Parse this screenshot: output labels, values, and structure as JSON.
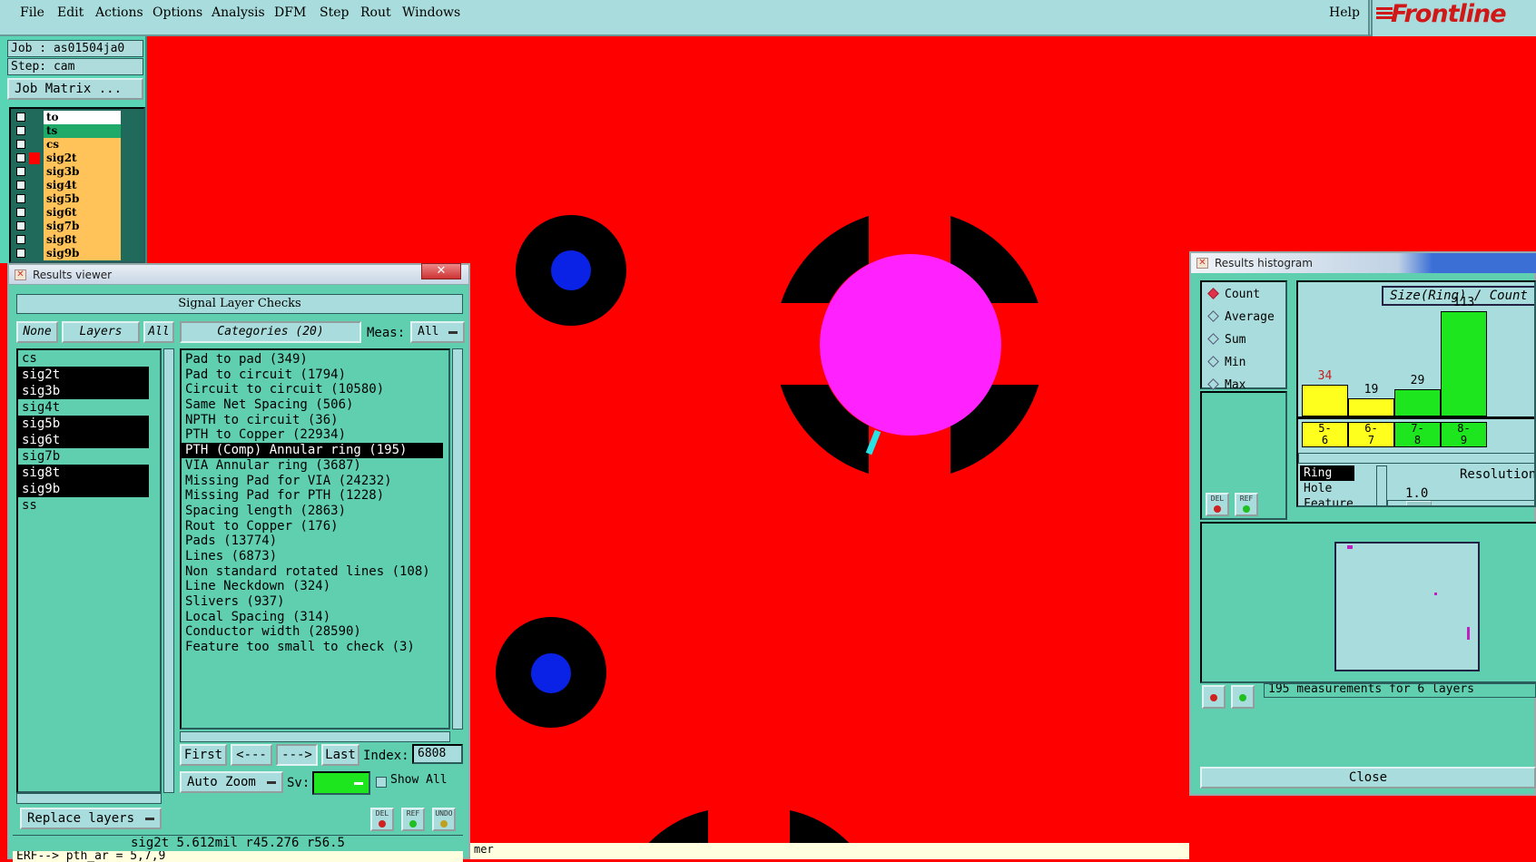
{
  "menu": {
    "items": [
      "File",
      "Edit",
      "Actions",
      "Options",
      "Analysis",
      "DFM",
      "Step",
      "Rout",
      "Windows"
    ],
    "help": "Help",
    "logo": "Frontline"
  },
  "left_panel": {
    "job": "Job : as01504ja0",
    "step": "Step: cam",
    "job_matrix": "Job Matrix ...",
    "layers": [
      {
        "name": "to",
        "color": "#ffffff"
      },
      {
        "name": "ts",
        "color": "#1faa6a"
      },
      {
        "name": "cs",
        "color": "#ffc35a"
      },
      {
        "name": "sig2t",
        "color": "#ffc35a",
        "marker": "#ff0000"
      },
      {
        "name": "sig3b",
        "color": "#ffc35a"
      },
      {
        "name": "sig4t",
        "color": "#ffc35a"
      },
      {
        "name": "sig5b",
        "color": "#ffc35a"
      },
      {
        "name": "sig6t",
        "color": "#ffc35a"
      },
      {
        "name": "sig7b",
        "color": "#ffc35a"
      },
      {
        "name": "sig8t",
        "color": "#ffc35a"
      },
      {
        "name": "sig9b",
        "color": "#ffc35a"
      }
    ]
  },
  "results_viewer": {
    "title": "Results viewer",
    "close": "✕",
    "header": "Signal Layer Checks",
    "none_btn": "None",
    "layers_btn": "Layers",
    "all_btn": "All",
    "categories_btn": "Categories (20)",
    "meas_label": "Meas:",
    "meas_value": "All",
    "layer_items": [
      {
        "name": "cs",
        "selected": false
      },
      {
        "name": "sig2t",
        "selected": true
      },
      {
        "name": "sig3b",
        "selected": true
      },
      {
        "name": "sig4t",
        "selected": false
      },
      {
        "name": "sig5b",
        "selected": true
      },
      {
        "name": "sig6t",
        "selected": true
      },
      {
        "name": "sig7b",
        "selected": false
      },
      {
        "name": "sig8t",
        "selected": true
      },
      {
        "name": "sig9b",
        "selected": true
      },
      {
        "name": "ss",
        "selected": false
      }
    ],
    "categories": [
      {
        "name": "Pad to pad (349)",
        "selected": false
      },
      {
        "name": "Pad to circuit (1794)",
        "selected": false
      },
      {
        "name": "Circuit to circuit (10580)",
        "selected": false
      },
      {
        "name": "Same Net Spacing (506)",
        "selected": false
      },
      {
        "name": "NPTH to circuit (36)",
        "selected": false
      },
      {
        "name": "PTH to Copper (22934)",
        "selected": false
      },
      {
        "name": "PTH (Comp) Annular ring (195)",
        "selected": true
      },
      {
        "name": "VIA Annular ring (3687)",
        "selected": false
      },
      {
        "name": "Missing Pad for VIA (24232)",
        "selected": false
      },
      {
        "name": "Missing Pad for PTH (1228)",
        "selected": false
      },
      {
        "name": "Spacing length (2863)",
        "selected": false
      },
      {
        "name": "Rout to Copper (176)",
        "selected": false
      },
      {
        "name": "Pads (13774)",
        "selected": false
      },
      {
        "name": "Lines (6873)",
        "selected": false
      },
      {
        "name": "Non standard rotated lines (108)",
        "selected": false
      },
      {
        "name": "Line Neckdown (324)",
        "selected": false
      },
      {
        "name": "Slivers (937)",
        "selected": false
      },
      {
        "name": "Local Spacing (314)",
        "selected": false
      },
      {
        "name": "Conductor width (28590)",
        "selected": false
      },
      {
        "name": "Feature too small to check (3)",
        "selected": false
      }
    ],
    "first": "First",
    "prev": "<---",
    "next": "--->",
    "last": "Last",
    "index_label": "Index:",
    "index_value": "6808",
    "auto_zoom": "Auto Zoom",
    "sv_label": "Sv:",
    "show_all": "Show All",
    "replace_layers": "Replace layers",
    "icon_del": "DEL",
    "icon_ref": "REF",
    "icon_und": "UNDO",
    "status_line": "sig2t 5.612mil  r45.276  r56.5",
    "command_line": "ERF--> pth_ar = 5,7,9"
  },
  "results_histogram": {
    "title": "Results histogram",
    "radio": [
      {
        "label": "Count",
        "on": true
      },
      {
        "label": "Average",
        "on": false
      },
      {
        "label": "Sum",
        "on": false
      },
      {
        "label": "Min",
        "on": false
      },
      {
        "label": "Max",
        "on": false
      }
    ],
    "chart_title": "Size(Ring) / Count",
    "bars": [
      {
        "label": "34",
        "bin": "5-\n6",
        "value": 34,
        "color": "#ffff1e",
        "label_color": "#c81e1e"
      },
      {
        "label": "19",
        "bin": "6-\n7",
        "value": 19,
        "color": "#ffff1e",
        "label_color": "#000000"
      },
      {
        "label": "29",
        "bin": "7-\n8",
        "value": 29,
        "color": "#1ee61e",
        "label_color": "#000000"
      },
      {
        "label": "113",
        "bin": "8-\n9",
        "value": 113,
        "color": "#1ee61e",
        "label_color": "#000000"
      }
    ],
    "modes": [
      "Ring",
      "Hole",
      "Feature"
    ],
    "resolution_label": "Resolution",
    "resolution_value": "1.0",
    "measurements": "195 measurements for 6 layers",
    "close": "Close"
  },
  "command_bottom": "mer"
}
